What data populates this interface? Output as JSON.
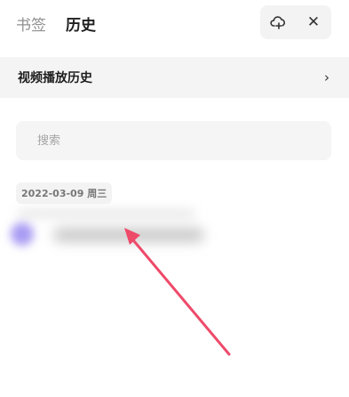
{
  "tabs": [
    {
      "label": "书签",
      "active": false
    },
    {
      "label": "历史",
      "active": true
    }
  ],
  "header": {
    "add_icon": "cloud-add-icon",
    "close_icon": "close-icon",
    "close_glyph": "✕"
  },
  "history_entry": {
    "label": "视频播放历史",
    "chevron": "›"
  },
  "search": {
    "placeholder": "搜索",
    "value": ""
  },
  "date_group": {
    "label": "2022-03-09 周三"
  },
  "annotation": {
    "arrow_color": "#ee4a6a"
  },
  "colors": {
    "accent_blur": "#a99cf3",
    "panel_bg": "#f4f4f4"
  }
}
